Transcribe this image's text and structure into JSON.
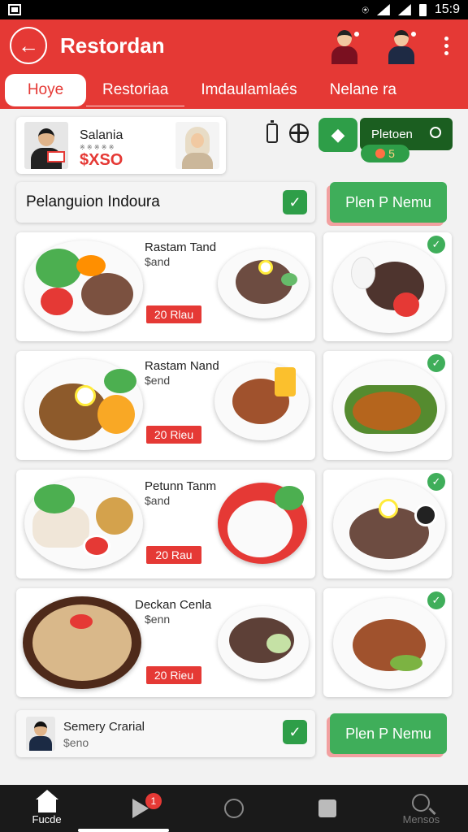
{
  "status_bar": {
    "time": "15:9"
  },
  "app_bar": {
    "title": "Restordan"
  },
  "tabs": [
    {
      "label": "Hoye"
    },
    {
      "label": "Restoriaa"
    },
    {
      "label": "Imdaulamlaés"
    },
    {
      "label": "Nelane ra"
    }
  ],
  "profile": {
    "name": "Salania",
    "subtitle": "※ ※ ※ ※ ※",
    "price": "$XSO"
  },
  "quick_actions": {
    "dark_button_label": "Pletoen",
    "count": "5"
  },
  "section": {
    "title": "Pelanguion Indoura"
  },
  "primary_button": {
    "label": "Plen P Nemu"
  },
  "dishes": [
    {
      "name": "Rastam Tand",
      "subtitle": "$and",
      "price": "20 Rlau"
    },
    {
      "name": "Rastam Nand",
      "subtitle": "$end",
      "price": "20 Rieu"
    },
    {
      "name": "Petunn Tanm",
      "subtitle": "$and",
      "price": "20 Rau"
    },
    {
      "name": "Deckan Cenla",
      "subtitle": "$enn",
      "price": "20 Rieu"
    }
  ],
  "footer_profile": {
    "name": "Semery Crarial",
    "subtitle": "$eno"
  },
  "footer_button": {
    "label": "Plen P Nemu"
  },
  "bottom_nav": [
    {
      "label": "Fucde",
      "icon": "home-icon"
    },
    {
      "label": "",
      "icon": "play-icon",
      "badge": "1"
    },
    {
      "label": "",
      "icon": "clock-icon"
    },
    {
      "label": "",
      "icon": "square-icon"
    },
    {
      "label": "Mensos",
      "icon": "search-icon"
    }
  ],
  "colors": {
    "brand_red": "#e53935",
    "green": "#2e9e48",
    "dark_green": "#1b5e20"
  }
}
